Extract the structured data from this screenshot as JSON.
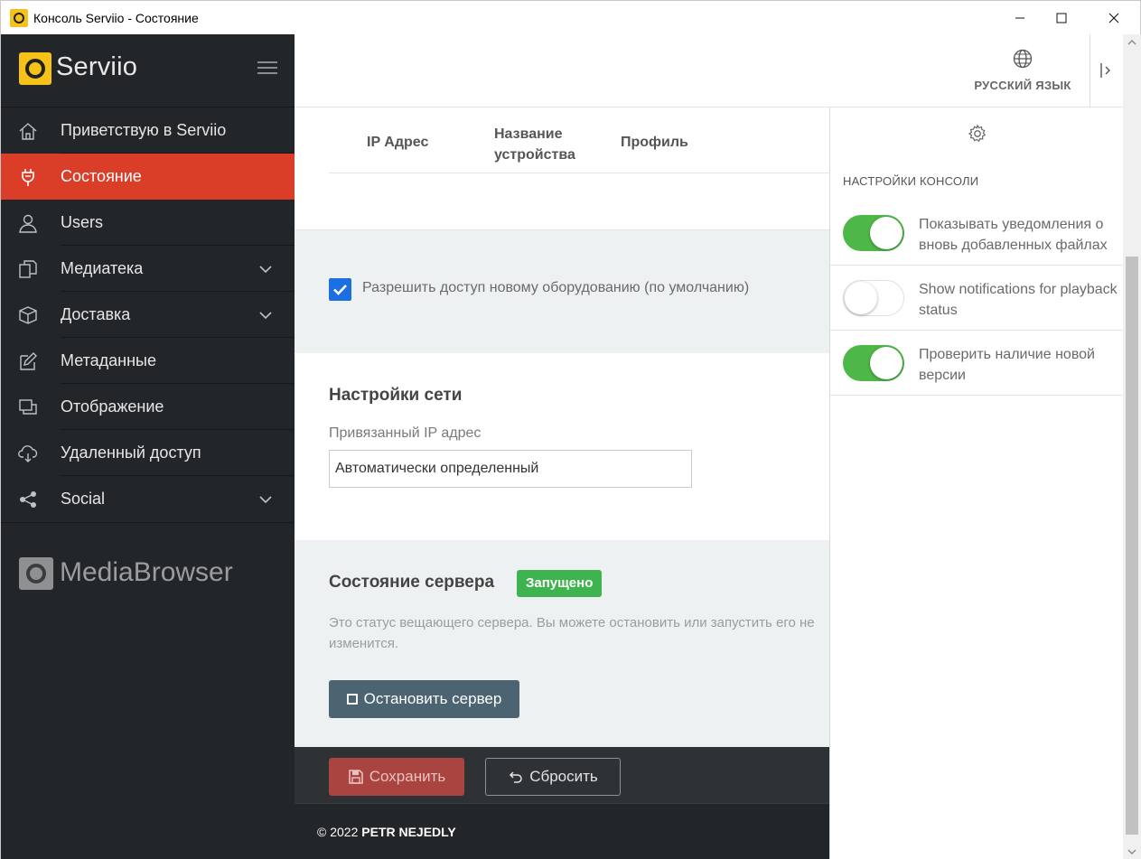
{
  "window": {
    "title": "Консоль Serviio - Состояние",
    "minimize_glyph": "—",
    "maximize_glyph": "☐",
    "close_glyph": "✕"
  },
  "sidebar": {
    "logo_text": "Serviio",
    "items": [
      {
        "label": "Приветствую в Serviio",
        "icon": "home-icon"
      },
      {
        "label": "Состояние",
        "icon": "plug-icon",
        "active": true
      },
      {
        "label": "Users",
        "icon": "user-icon"
      },
      {
        "label": "Медиатека",
        "icon": "library-icon",
        "has_submenu": true
      },
      {
        "label": "Доставка",
        "icon": "box-icon",
        "has_submenu": true
      },
      {
        "label": "Метаданные",
        "icon": "edit-icon"
      },
      {
        "label": "Отображение",
        "icon": "display-icon"
      },
      {
        "label": "Удаленный доступ",
        "icon": "cloud-icon"
      },
      {
        "label": "Social",
        "icon": "share-icon",
        "has_submenu": true
      }
    ],
    "mediabrowser_text": "MediaBrowser"
  },
  "header": {
    "language_label": "РУССКИЙ ЯЗЫК"
  },
  "devices_table": {
    "columns": [
      "IP Адрес",
      "Название устройства",
      "Профиль"
    ]
  },
  "access": {
    "checkbox_label": "Разрешить доступ новому оборудованию (по умолчанию)",
    "checked": true
  },
  "network": {
    "title": "Настройки сети",
    "bound_ip_label": "Привязанный IP адрес",
    "bound_ip_value": "Автоматически определенный"
  },
  "server": {
    "title": "Состояние сервера",
    "status_badge": "Запущено",
    "description": "Это статус вещающего сервера. Вы можете остановить или запустить его не изменится.",
    "stop_button": "Остановить сервер"
  },
  "actions": {
    "save_label": "Сохранить",
    "reset_label": "Сбросить"
  },
  "footer": {
    "copyright_prefix": "© 2022",
    "copyright_name": "PETR NEJEDLY"
  },
  "console_settings": {
    "heading": "НАСТРОЙКИ КОНСОЛИ",
    "options": [
      {
        "label": "Показывать уведомления о вновь добавленных файлах",
        "enabled": true
      },
      {
        "label": "Show notifications for playback status",
        "enabled": false
      },
      {
        "label": "Проверить наличие новой версии",
        "enabled": true
      }
    ]
  },
  "colors": {
    "sidebar_bg": "#232629",
    "active_item": "#da3e28",
    "accent_yellow": "#f6c21a",
    "toggle_on": "#4db848",
    "badge_green": "#3fb34f",
    "stop_button": "#4c6472",
    "save_button": "#a94440",
    "checkbox_blue": "#1b6fe0"
  }
}
